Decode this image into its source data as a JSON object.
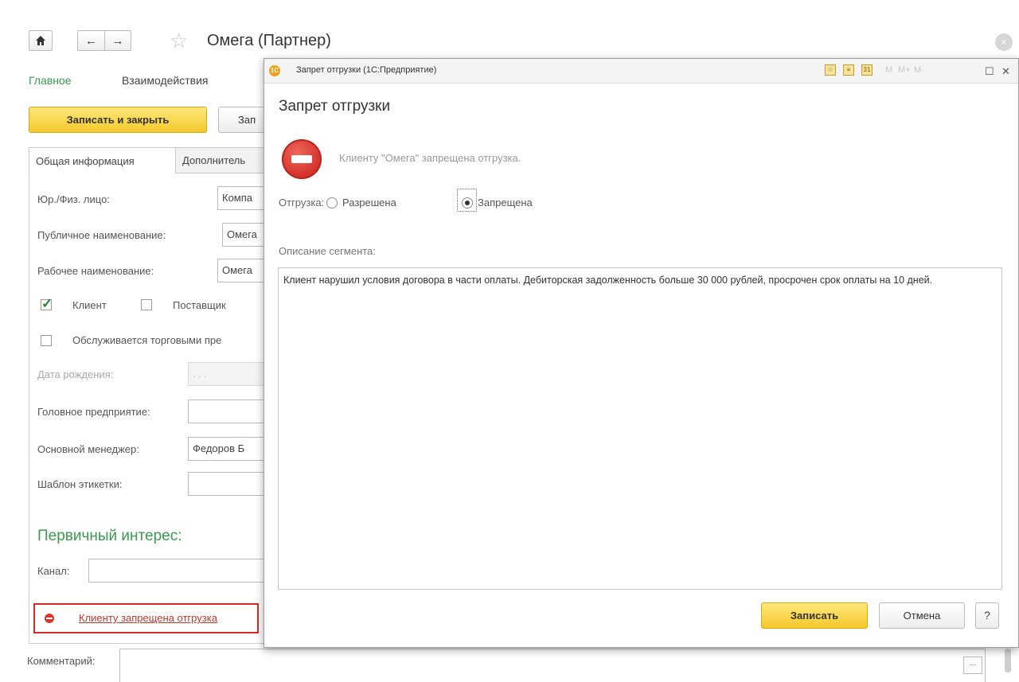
{
  "window": {
    "title": "Омега (Партнер)",
    "close_glyph": "×"
  },
  "nav": {
    "home_icon": "home-icon",
    "back_glyph": "←",
    "forward_glyph": "→",
    "star_glyph": "☆",
    "tabs": [
      "Главное",
      "Взаимодействия"
    ]
  },
  "toolbar": {
    "save_close_label": "Записать и закрыть",
    "save_label_partial": "Зап"
  },
  "form_tabs": {
    "general": "Общая информация",
    "additional": "Дополнитель"
  },
  "form": {
    "legal_label": "Юр./Физ. лицо:",
    "legal_value": "Компа",
    "public_name_label": "Публичное наименование:",
    "public_name_value": "Омега",
    "work_name_label": "Рабочее наименование:",
    "work_name_value": "Омега",
    "client_label": "Клиент",
    "client_checked": true,
    "supplier_label": "Поставщик",
    "supplier_checked": false,
    "serviced_label": "Обслуживается торговыми пре",
    "serviced_checked": false,
    "birth_label": "Дата рождения:",
    "birth_value": ". . .",
    "head_label": "Головное предприятие:",
    "head_value": "",
    "manager_label": "Основной менеджер:",
    "manager_value": "Федоров Б",
    "label_template_label": "Шаблон этикетки:",
    "label_template_value": "",
    "primary_interest_title": "Первичный интерес:",
    "channel_label": "Канал:",
    "channel_value": "",
    "warning_link": "Клиенту запрещена отгрузка",
    "comment_label": "Комментарий:",
    "comment_value": "",
    "dots": "..."
  },
  "modal": {
    "window_title": "Запрет отгрузки (1С:Предприятие)",
    "toolbar_m": [
      "M",
      "M+",
      "M-"
    ],
    "maximize_glyph": "☐",
    "close_glyph": "✕",
    "heading": "Запрет отгрузки",
    "message": "Клиенту \"Омега\" запрещена отгрузка.",
    "shipment_label": "Отгрузка:",
    "option_allowed": "Разрешена",
    "option_forbidden": "Запрещена",
    "selected_option": "Запрещена",
    "description_label": "Описание сегмента:",
    "description_text": "Клиент нарушил условия договора в части оплаты. Дебиторская задолженность больше 30 000 рублей, просрочен срок оплаты на 10 дней.",
    "save_button": "Записать",
    "cancel_button": "Отмена",
    "help_button": "?"
  },
  "colors": {
    "accent_green": "#3a9a4f",
    "button_yellow": "#f5c92c",
    "warning_red": "#d92a2a"
  }
}
